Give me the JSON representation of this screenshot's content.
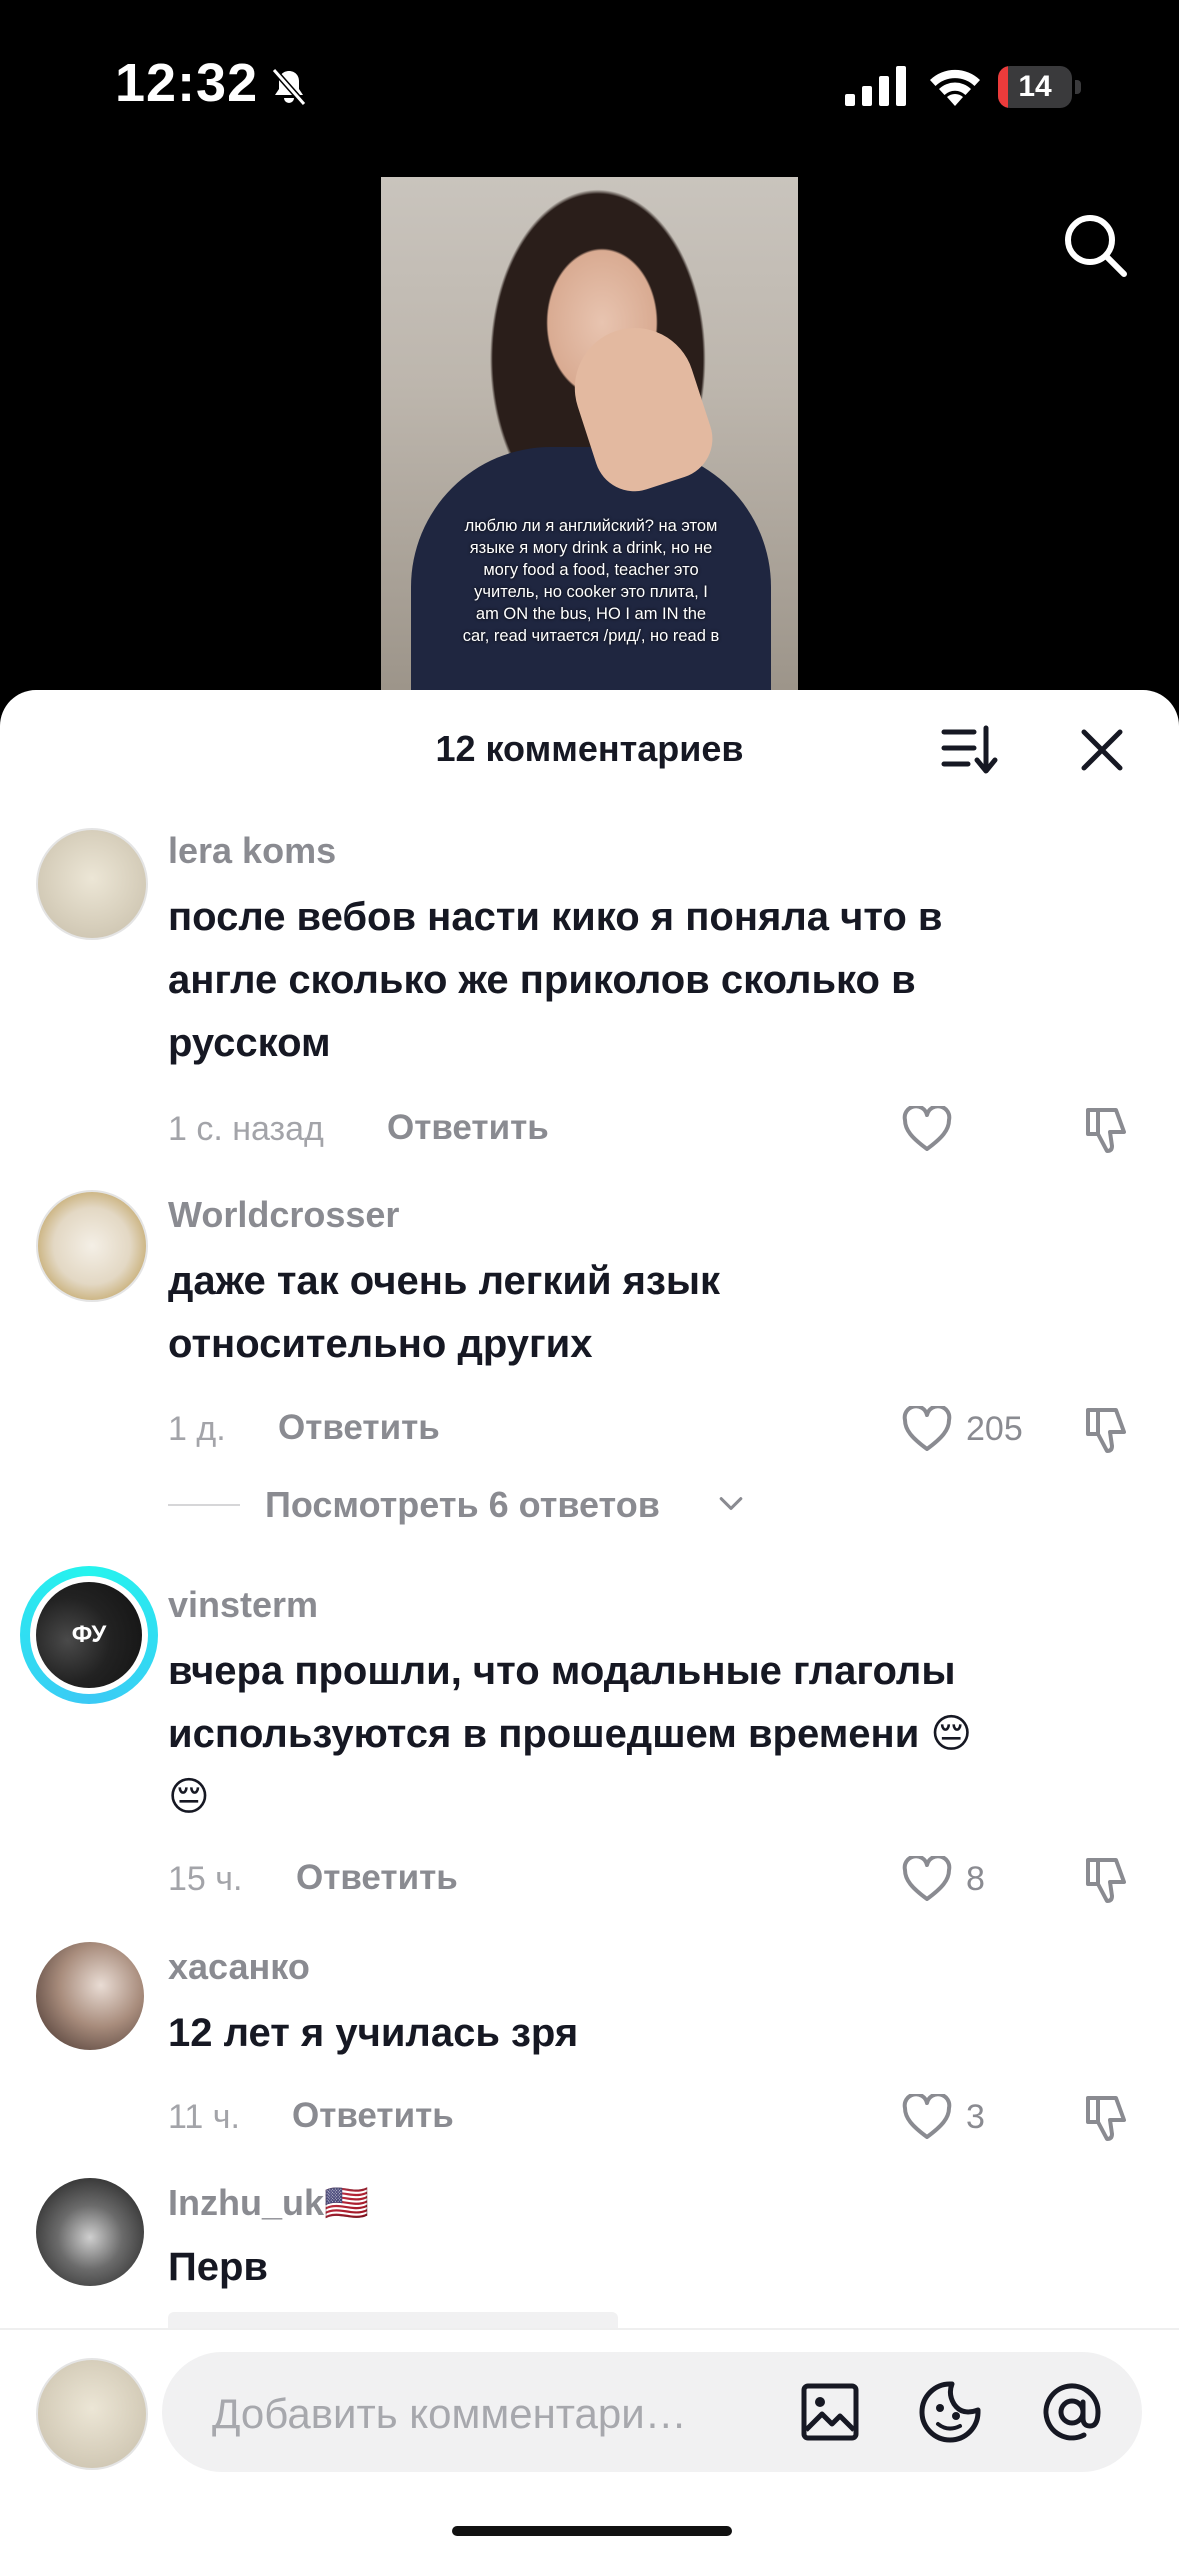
{
  "status_bar": {
    "time": "12:32",
    "battery": "14",
    "battery_level": 0.14
  },
  "video": {
    "caption": "люблю ли я английский? на этом языке я могу drink a drink, но не могу food a food, teacher это учитель, но cooker это плита, I am ON the bus, НО I am IN the car, read читается /рид/, но read в"
  },
  "sheet": {
    "title": "12 комментариев"
  },
  "comments": [
    {
      "user": "lera koms",
      "lines": [
        "после вебов насти кико я поняла что в",
        "англе сколько же приколов сколько в",
        "русском"
      ],
      "time": "1 с. назад",
      "reply": "Ответить",
      "likes": ""
    },
    {
      "user": "Worldcrosser",
      "lines": [
        "даже так очень легкий язык",
        "относительно других"
      ],
      "time": "1 д.",
      "reply": "Ответить",
      "likes": "205",
      "view_replies": "Посмотреть 6 ответов"
    },
    {
      "user": "vinsterm",
      "avatar_text": "ФУ",
      "lines": [
        "вчера прошли, что модальные глаголы",
        "используются в прошедшем времени 😔",
        "😔"
      ],
      "time": "15 ч.",
      "reply": "Ответить",
      "likes": "8"
    },
    {
      "user": "хасанко",
      "lines": [
        "12 лет я училась зря"
      ],
      "time": "11 ч.",
      "reply": "Ответить",
      "likes": "3"
    },
    {
      "user": "Inzhu_uk🇺🇸",
      "lines": [
        "Перв"
      ]
    }
  ],
  "input": {
    "placeholder": "Добавить комментари…"
  },
  "colors": {
    "accent_ring": "#25f4ee",
    "battery_red": "#eb3b3b",
    "text_primary": "#161823",
    "text_secondary": "#8a8b91"
  }
}
